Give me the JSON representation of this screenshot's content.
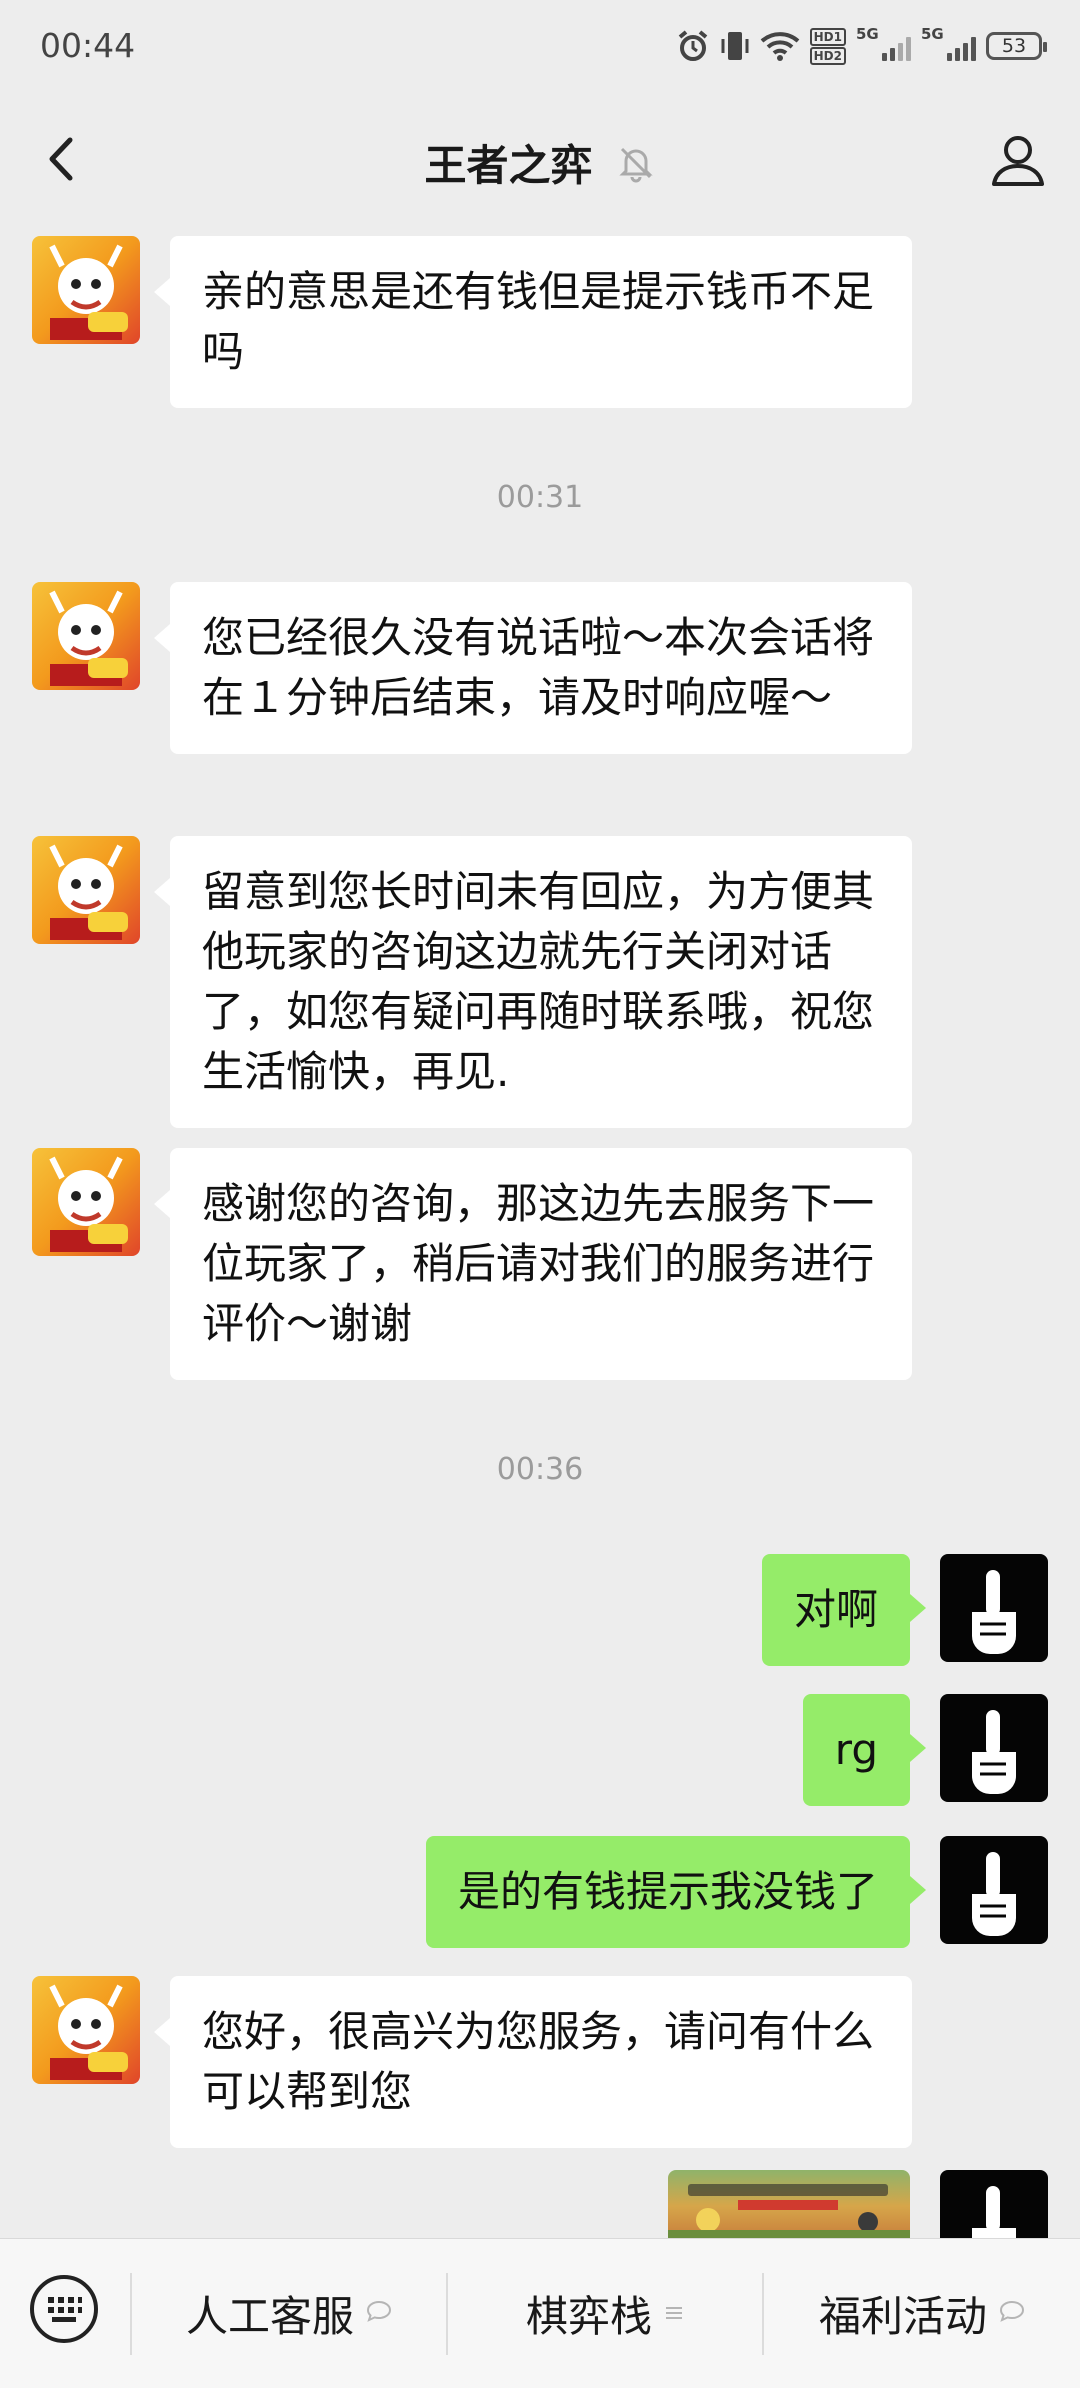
{
  "status_bar": {
    "time": "00:44",
    "hd_label_1": "HD1",
    "hd_label_2": "HD2",
    "network_1": "5G",
    "network_2": "5G",
    "battery": "53"
  },
  "header": {
    "title": "王者之弈",
    "muted": true
  },
  "messages": [
    {
      "sender": "bot",
      "text": "亲的意思是还有钱但是提示钱币不足吗"
    },
    {
      "type": "time",
      "text": "00:31"
    },
    {
      "sender": "bot",
      "text": "您已经很久没有说话啦～本次会话将在１分钟后结束，请及时响应喔～"
    },
    {
      "sender": "bot",
      "text": "留意到您长时间未有回应，为方便其他玩家的咨询这边就先行关闭对话了，如您有疑问再随时联系哦，祝您生活愉快，再见."
    },
    {
      "sender": "bot",
      "text": "感谢您的咨询，那这边先去服务下一位玩家了，稍后请对我们的服务进行评价～谢谢"
    },
    {
      "type": "time",
      "text": "00:36"
    },
    {
      "sender": "me",
      "text": "对啊"
    },
    {
      "sender": "me",
      "text": "rg"
    },
    {
      "sender": "me",
      "text": "是的有钱提示我没钱了"
    },
    {
      "sender": "bot",
      "text": "您好，很高兴为您服务，请问有什么可以帮到您"
    },
    {
      "sender": "me",
      "type": "image"
    }
  ],
  "bottom_menu": {
    "items": [
      {
        "label": "人工客服"
      },
      {
        "label": "棋弈栈"
      },
      {
        "label": "福利活动"
      }
    ]
  },
  "colors": {
    "background": "#ededed",
    "my_bubble": "#95ec69",
    "bot_bubble": "#ffffff"
  }
}
